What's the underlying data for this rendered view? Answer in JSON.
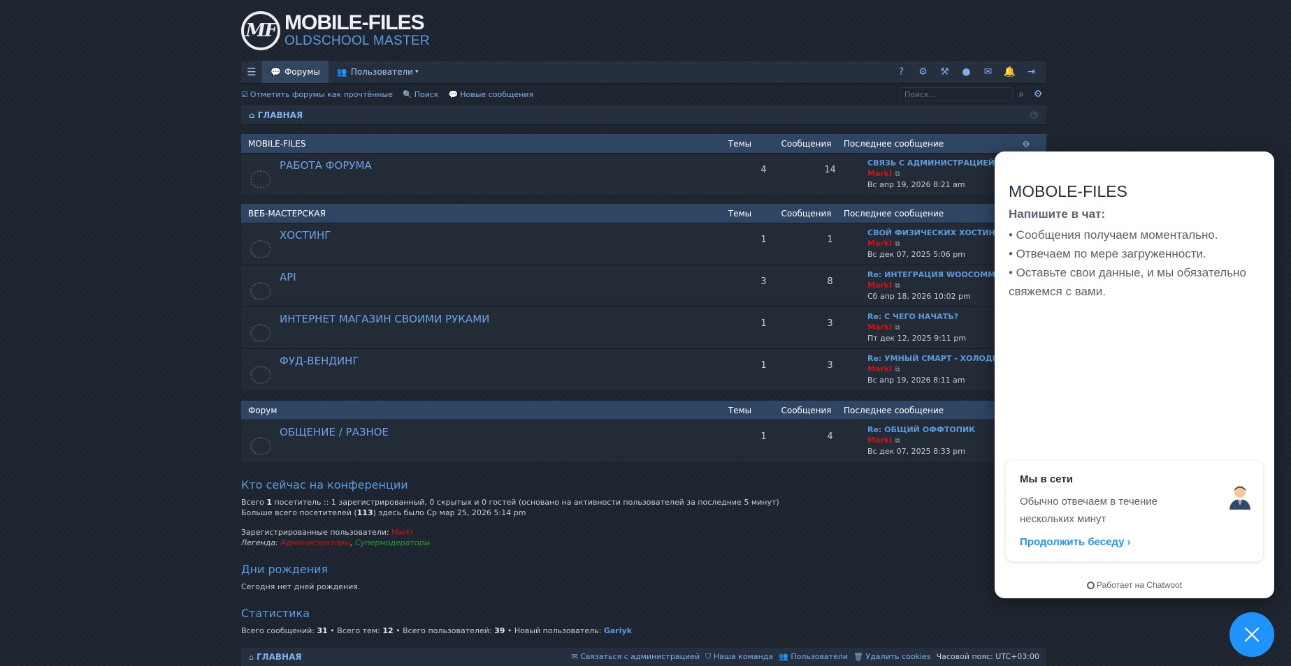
{
  "logo": {
    "mark": "MF",
    "title": "MOBILE-FILES",
    "subtitle": "OLDSCHOOL MASTER"
  },
  "nav": {
    "tabs": [
      {
        "label": "Форумы",
        "icon": "comment-icon"
      },
      {
        "label": "Пользователи",
        "icon": "users-icon"
      }
    ],
    "right_icons": [
      "help-icon",
      "cogs-icon",
      "gavel-icon",
      "user-icon",
      "inbox-icon",
      "bell-icon",
      "sign-out-icon"
    ]
  },
  "subbar": {
    "mark_read": "Отметить форумы как прочтённые",
    "search": "Поиск",
    "new_posts": "Новые сообщения",
    "search_placeholder": "Поиск..."
  },
  "breadcrumb": {
    "home": "ГЛАВНАЯ"
  },
  "columns": {
    "topics": "Темы",
    "posts": "Сообщения",
    "last": "Последнее сообщение"
  },
  "categories": [
    {
      "title": "MOBILE-FILES",
      "forums": [
        {
          "name": "РАБОТА ФОРУМА",
          "topics": "4",
          "posts": "14",
          "last_title": "СВЯЗЬ С АДМИНИСТРАЦИЕЙ",
          "last_author": "MarkI",
          "last_date": "Вс апр 19, 2026 8:21 am"
        }
      ]
    },
    {
      "title": "ВЕБ-МАСТЕРСКАЯ",
      "forums": [
        {
          "name": "ХОСТИНГ",
          "topics": "1",
          "posts": "1",
          "last_title": "СВОЙ ФИЗИЧЕСКИХ ХОСТИНГ",
          "last_author": "MarkI",
          "last_date": "Вс дек 07, 2025 5:06 pm"
        },
        {
          "name": "API",
          "topics": "3",
          "posts": "8",
          "last_title": "Re: ИНТЕГРАЦИЯ WOOCOMMERCE",
          "last_author": "MarkI",
          "last_date": "Сб апр 18, 2026 10:02 pm"
        },
        {
          "name": "ИНТЕРНЕТ МАГАЗИН СВОИМИ РУКАМИ",
          "topics": "1",
          "posts": "3",
          "last_title": "Re: С ЧЕГО НАЧАТЬ?",
          "last_author": "MarkI",
          "last_date": "Пт дек 12, 2025 9:11 pm"
        },
        {
          "name": "ФУД-ВЕНДИНГ",
          "topics": "1",
          "posts": "3",
          "last_title": "Re: УМНЫЙ СМАРТ - ХОЛОДИЛЬНИК",
          "last_author": "MarkI",
          "last_date": "Вс апр 19, 2026 8:11 am"
        }
      ]
    },
    {
      "title": "Форум",
      "forums": [
        {
          "name": "ОБЩЕНИЕ / РАЗНОЕ",
          "topics": "1",
          "posts": "4",
          "last_title": "Re: ОБЩИЙ ОФФТОПИК",
          "last_author": "MarkI",
          "last_date": "Вс дек 07, 2025 8:33 pm"
        }
      ]
    }
  ],
  "online": {
    "title": "Кто сейчас на конференции",
    "line1_pre": "Всего ",
    "line1_count": "1",
    "line1_post": " посетитель :: 1 зарегистрированный, 0 скрытых и 0 гостей (основано на активности пользователей за последние 5 минут)",
    "line2_pre": "Больше всего посетителей (",
    "line2_count": "113",
    "line2_post": ") здесь было Ср мар 25, 2026 5:14 pm",
    "registered_label": "Зарегистрированные пользователи: ",
    "registered_user": "MarkI",
    "legend_label": "Легенда: ",
    "legend_admin": "Администраторы",
    "legend_sep": ", ",
    "legend_mods": "Супермодераторы"
  },
  "birthdays": {
    "title": "Дни рождения",
    "text": "Сегодня нет дней рождения."
  },
  "stats": {
    "title": "Статистика",
    "posts_label": "Всего сообщений: ",
    "posts": "31",
    "topics_label": " • Всего тем: ",
    "topics": "12",
    "users_label": " • Всего пользователей: ",
    "users": "39",
    "newest_label": " • Новый пользователь: ",
    "newest": "Gariyk"
  },
  "footer": {
    "home": "ГЛАВНАЯ",
    "contact": "Связаться с администрацией",
    "team": "Наша команда",
    "members": "Пользователи",
    "cookies": "Удалить cookies",
    "timezone": "Часовой пояс: UTC+03:00"
  },
  "chat": {
    "title": "MOBOLE-FILES",
    "subtitle": "Напишите в чат:",
    "lines": [
      "• Сообщения получаем моментально.",
      "• Отвечаем по мере загруженности.",
      "• Оставьте свои данные, и мы обязательно свяжемся с вами."
    ],
    "status_title": "Мы в сети",
    "status_text": "Обычно отвечаем в течение нескольких минут",
    "continue": "Продолжить беседу",
    "powered": "Работает на Chatwoot",
    "accent": "#1f93ff"
  }
}
